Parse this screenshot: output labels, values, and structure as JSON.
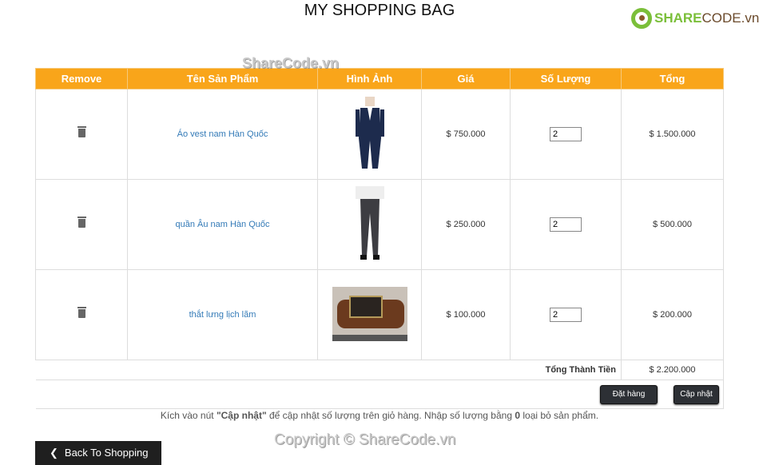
{
  "page": {
    "title": "MY SHOPPING BAG"
  },
  "logo": {
    "text_green": "SHARE",
    "text_brown": "CODE.vn"
  },
  "watermarks": {
    "top": "ShareCode.vn",
    "bottom": "Copyright © ShareCode.vn"
  },
  "table": {
    "headers": [
      "Remove",
      "Tên Sản Phẩm",
      "Hình Ảnh",
      "Giá",
      "Số Lượng",
      "Tổng"
    ],
    "rows": [
      {
        "name": "Áo vest nam Hàn Quốc",
        "price": "$ 750.000",
        "qty": "2",
        "total": "$ 1.500.000",
        "image": "suit"
      },
      {
        "name": "quần Âu nam Hàn Quốc",
        "price": "$ 250.000",
        "qty": "2",
        "total": "$ 500.000",
        "image": "trousers"
      },
      {
        "name": "thắt lưng lịch lãm",
        "price": "$ 100.000",
        "qty": "2",
        "total": "$ 200.000",
        "image": "belt"
      }
    ],
    "grand_total_label": "Tổng Thành Tiền",
    "grand_total": "$ 2.200.000"
  },
  "buttons": {
    "order": "Đặt hàng",
    "update": "Cập nhật",
    "back": "Back To Shopping"
  },
  "note": {
    "p1": "Kích vào nút ",
    "b1": "\"Cập nhật\"",
    "p2": " để cập nhật số lượng trên giỏ hàng. Nhập số lượng bằng ",
    "b2": "0",
    "p3": " loại bỏ sản phẩm."
  }
}
